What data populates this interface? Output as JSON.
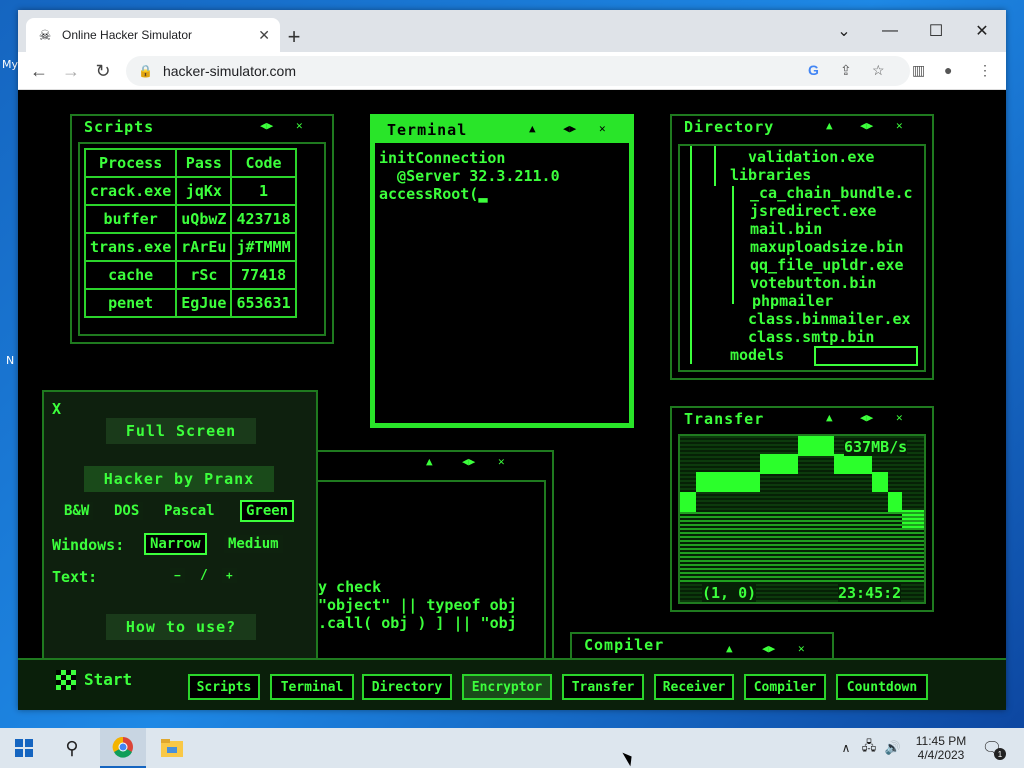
{
  "desktop": {
    "icon1": "My",
    "icon2": "N"
  },
  "browser": {
    "tab_title": "Online Hacker Simulator",
    "tab_close": "✕",
    "new_tab": "+",
    "url": "hacker-simulator.com"
  },
  "scripts": {
    "title": "Scripts",
    "headers": [
      "Process",
      "Pass",
      "Code"
    ],
    "rows": [
      [
        "crack.exe",
        "jqKx",
        "1"
      ],
      [
        "buffer",
        "uQbwZ",
        "423718"
      ],
      [
        "trans.exe",
        "rArEu",
        "j#TMMM"
      ],
      [
        "cache",
        "rSc",
        "77418"
      ],
      [
        "penet",
        "EgJue",
        "653631"
      ]
    ]
  },
  "terminal": {
    "title": "Terminal",
    "lines": [
      "initConnection",
      "  @Server 32.3.211.0",
      "accessRoot(▂"
    ]
  },
  "directory": {
    "title": "Directory",
    "lines": [
      "validation.exe",
      "libraries",
      "_ca_chain_bundle.c",
      "jsredirect.exe",
      "mail.bin",
      "maxuploadsize.bin",
      "qq_file_upldr.exe",
      "votebutton.bin",
      "phpmailer",
      "class.binmailer.ex",
      "class.smtp.bin",
      "models"
    ]
  },
  "settings": {
    "close": "X",
    "full_screen": "Full Screen",
    "brand": "Hacker by Pranx",
    "themes": [
      "B&W",
      "DOS",
      "Pascal",
      "Green"
    ],
    "windows_label": "Windows:",
    "window_opts": [
      "Narrow",
      "Medium"
    ],
    "text_label": "Text:",
    "text_minus": "−",
    "text_slash": "/",
    "text_plus": "+",
    "how_to": "How to use?"
  },
  "encryptor": {
    "lines": [
      "y check",
      "\"object\" || typeof obj",
      ".call( obj ) ] || \"obj"
    ]
  },
  "transfer": {
    "title": "Transfer",
    "speed": "637MB/s",
    "coords": "(1, 0)",
    "clock": "23:45:2"
  },
  "compiler": {
    "title": "Compiler"
  },
  "hacker_taskbar": {
    "start": "Start",
    "buttons": [
      "Scripts",
      "Terminal",
      "Directory",
      "Encryptor",
      "Transfer",
      "Receiver",
      "Compiler",
      "Countdown"
    ]
  },
  "windows_taskbar": {
    "time": "11:45 PM",
    "date": "4/4/2023",
    "notif_count": "1"
  }
}
